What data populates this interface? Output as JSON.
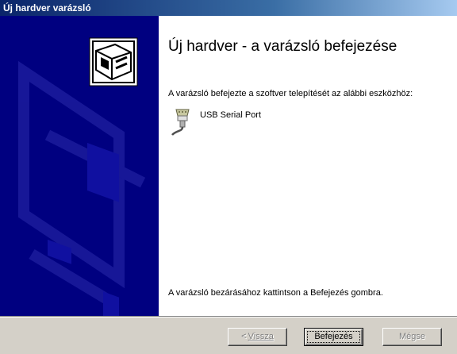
{
  "window": {
    "title": "Új hardver varázsló"
  },
  "main": {
    "heading": "Új hardver - a varázsló befejezése",
    "intro_text": "A varázsló befejezte a szoftver telepítését az alábbi eszközhöz:",
    "device": {
      "icon": "serial-port-plug-icon",
      "name": "USB Serial Port"
    },
    "finish_text": "A varázsló bezárásához kattintson a Befejezés gombra."
  },
  "buttons": {
    "back_arrow": "<",
    "back_label": "Vissza",
    "finish_label": "Befejezés",
    "cancel_label": "Mégse"
  },
  "colors": {
    "titlebar": "#0a246a",
    "banner": "#000080",
    "face": "#d4d0c8"
  }
}
